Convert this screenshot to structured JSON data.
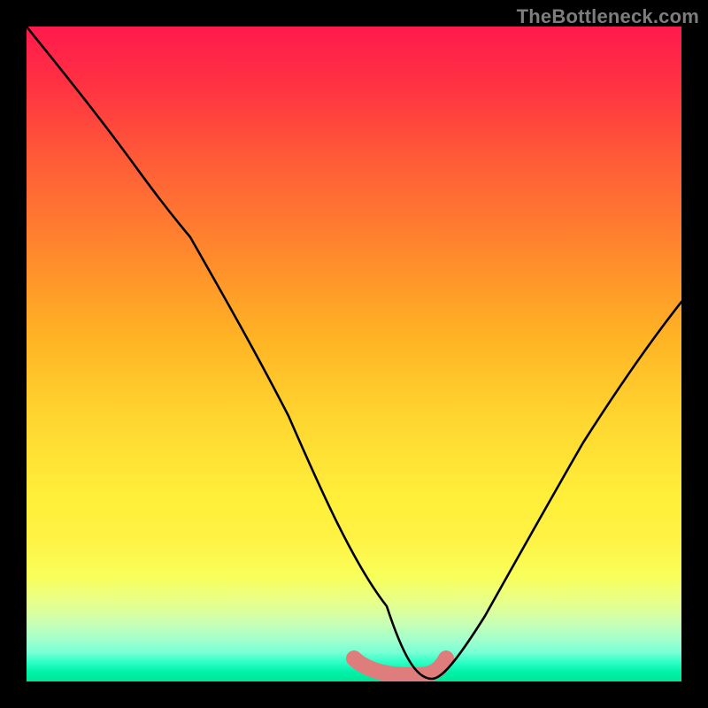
{
  "watermark": "TheBottleneck.com",
  "chart_data": {
    "type": "line",
    "title": "",
    "xlabel": "",
    "ylabel": "",
    "xlim": [
      0,
      100
    ],
    "ylim": [
      0,
      100
    ],
    "grid": false,
    "legend": null,
    "series": [
      {
        "name": "bottleneck-curve",
        "color": "#000000",
        "x": [
          0,
          5,
          10,
          15,
          19,
          25,
          30,
          35,
          40,
          45,
          50,
          55,
          60,
          62,
          65,
          70,
          75,
          80,
          85,
          90,
          95,
          100
        ],
        "y": [
          100,
          94,
          88,
          82,
          77,
          68,
          59,
          50,
          40,
          29,
          18,
          8,
          0,
          0,
          2,
          10,
          19,
          28,
          37,
          45,
          52,
          58
        ]
      }
    ],
    "annotations": [
      {
        "name": "valley-highlight",
        "color": "#df7c7c",
        "x": [
          50,
          52,
          55,
          57,
          59,
          60,
          61,
          62,
          63,
          64
        ],
        "y": [
          3.5,
          2.4,
          1.6,
          1.1,
          0.9,
          0.9,
          1.0,
          1.2,
          2.0,
          3.5
        ]
      }
    ],
    "gradient_stops": [
      {
        "pos": 0.0,
        "color": "#ff1a4d"
      },
      {
        "pos": 0.2,
        "color": "#ff5a38"
      },
      {
        "pos": 0.48,
        "color": "#ffb524"
      },
      {
        "pos": 0.72,
        "color": "#ffef3a"
      },
      {
        "pos": 0.88,
        "color": "#e6ff8c"
      },
      {
        "pos": 0.97,
        "color": "#30ffc8"
      },
      {
        "pos": 1.0,
        "color": "#00e697"
      }
    ]
  }
}
